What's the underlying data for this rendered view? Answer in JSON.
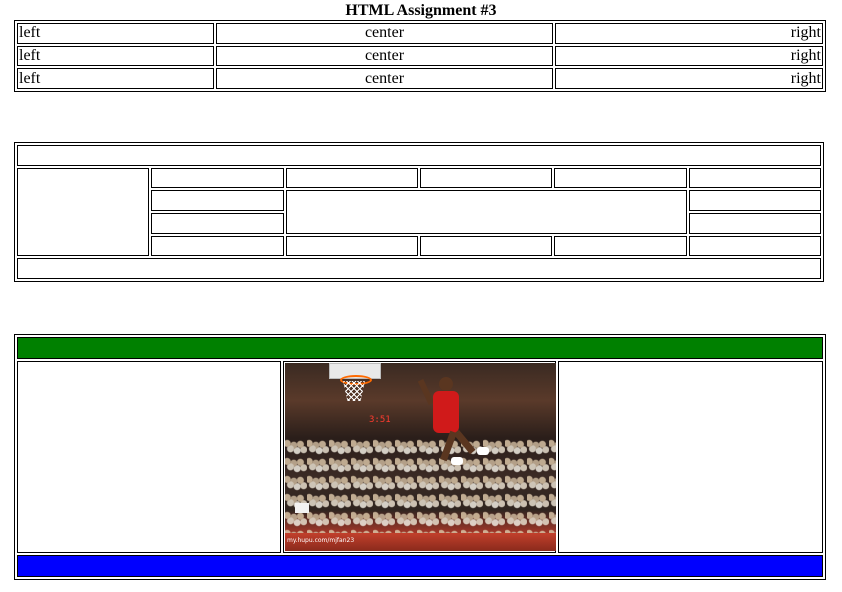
{
  "page": {
    "title": "HTML Assignment #3"
  },
  "table1": {
    "rows": [
      {
        "left": "left",
        "center": "center",
        "right": "right"
      },
      {
        "left": "left",
        "center": "center",
        "right": "right"
      },
      {
        "left": "left",
        "center": "center",
        "right": "right"
      }
    ]
  },
  "table3": {
    "colors": {
      "header_bar": "#008000",
      "footer_bar": "#0000ff"
    },
    "image": {
      "icon": "basketball-photo",
      "scoreboard_text": "3:51",
      "caption": "my.hupu.com/mjfan23"
    }
  }
}
